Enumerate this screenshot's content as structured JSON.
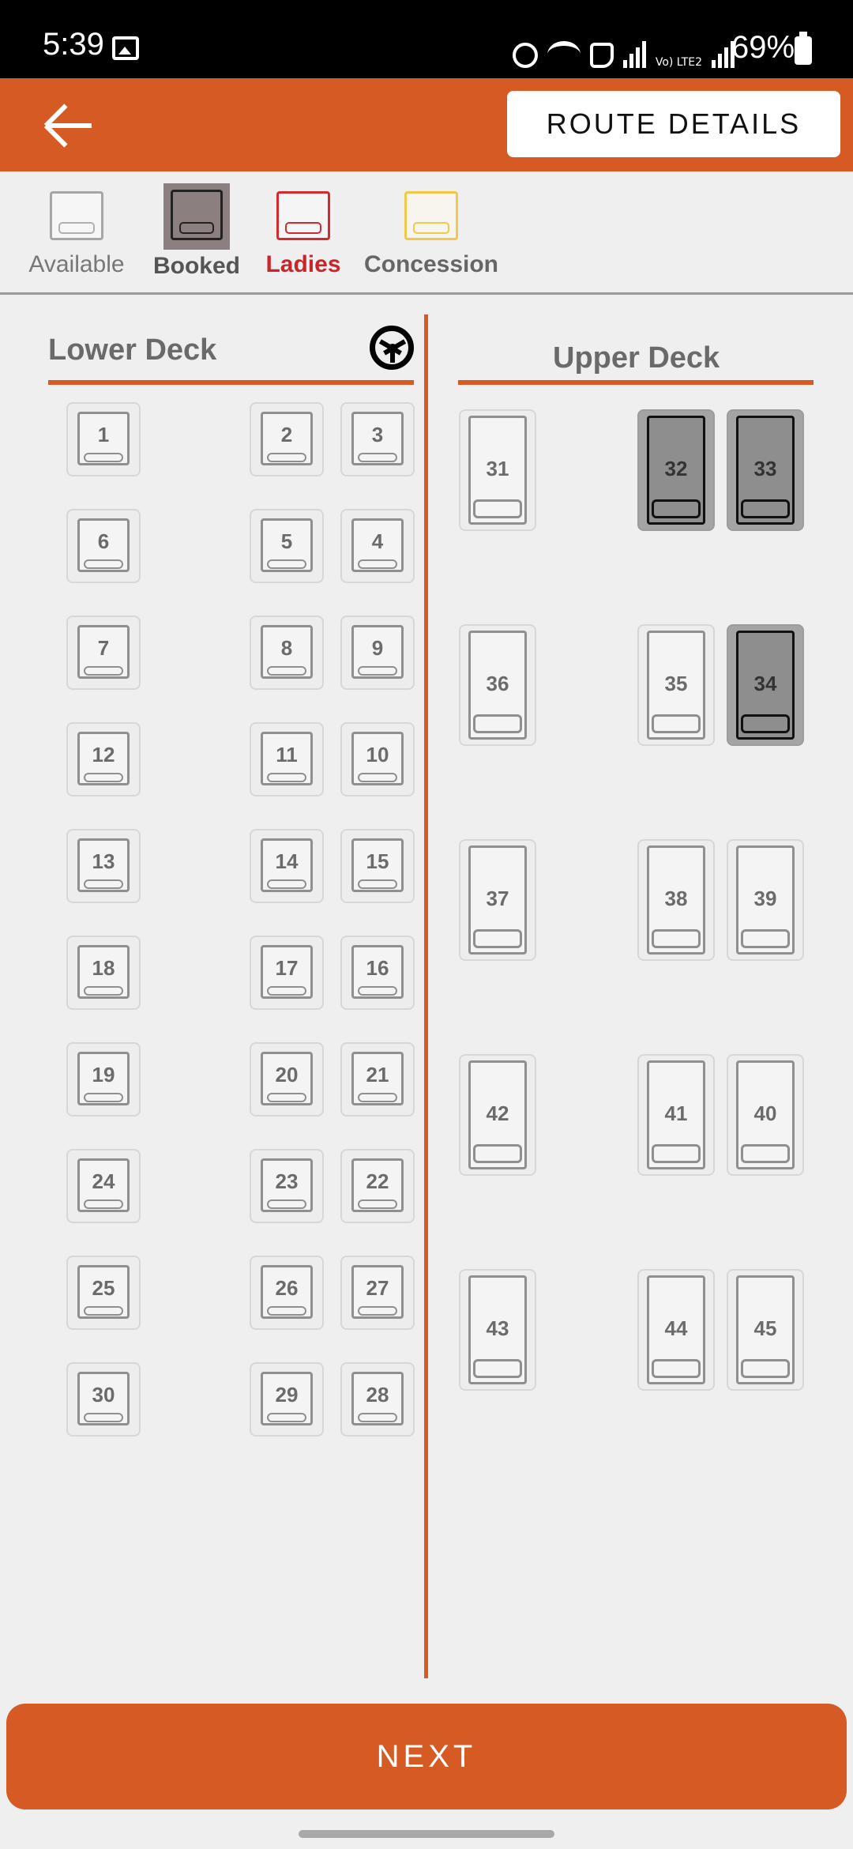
{
  "status_bar": {
    "time": "5:39",
    "battery": "69%",
    "network_label": "Vo) LTE2"
  },
  "toolbar": {
    "route_details": "ROUTE DETAILS"
  },
  "legend": {
    "available": "Available",
    "booked": "Booked",
    "ladies": "Ladies",
    "concession": "Concession"
  },
  "lower_deck": {
    "title": "Lower Deck",
    "seats": [
      "1",
      "2",
      "3",
      "6",
      "5",
      "4",
      "7",
      "8",
      "9",
      "12",
      "11",
      "10",
      "13",
      "14",
      "15",
      "18",
      "17",
      "16",
      "19",
      "20",
      "21",
      "24",
      "23",
      "22",
      "25",
      "26",
      "27",
      "30",
      "29",
      "28"
    ]
  },
  "upper_deck": {
    "title": "Upper Deck",
    "seats": [
      "31",
      "32",
      "33",
      "36",
      "35",
      "34",
      "37",
      "38",
      "39",
      "42",
      "41",
      "40",
      "43",
      "44",
      "45"
    ],
    "booked": [
      "32",
      "33",
      "34"
    ]
  },
  "actions": {
    "next": "NEXT"
  },
  "colors": {
    "accent": "#d65a24",
    "booked": "#8c7f80",
    "ladies": "#d12a2f",
    "concession": "#f0c84a"
  }
}
